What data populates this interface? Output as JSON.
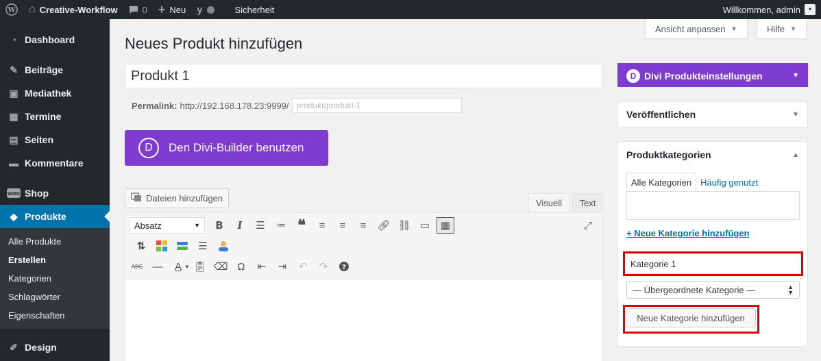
{
  "adminbar": {
    "site_name": "Creative-Workflow",
    "comments_count": "0",
    "new_label": "Neu",
    "security_label": "Sicherheit",
    "greeting": "Willkommen, admin",
    "icons": [
      "wordpress-icon",
      "home-icon",
      "comment-icon",
      "plus-icon",
      "yoast-icon",
      "status-dot-icon",
      "avatar"
    ]
  },
  "sidebar": {
    "items": [
      {
        "label": "Dashboard",
        "icon": "dashboard-icon"
      },
      {
        "label": "Beiträge",
        "icon": "pin-icon"
      },
      {
        "label": "Mediathek",
        "icon": "media-icon"
      },
      {
        "label": "Termine",
        "icon": "calendar-icon"
      },
      {
        "label": "Seiten",
        "icon": "page-icon"
      },
      {
        "label": "Kommentare",
        "icon": "comment-icon"
      },
      {
        "label": "Shop",
        "icon": "woo-icon"
      },
      {
        "label": "Produkte",
        "icon": "product-icon"
      },
      {
        "label": "Design",
        "icon": "brush-icon"
      }
    ],
    "submenu": [
      "Alle Produkte",
      "Erstellen",
      "Kategorien",
      "Schlagwörter",
      "Eigenschaften"
    ],
    "active_sub": "Erstellen",
    "accent": "#0073aa"
  },
  "header": {
    "title": "Neues Produkt hinzufügen",
    "screen_options": "Ansicht anpassen",
    "help": "Hilfe"
  },
  "post": {
    "title_value": "Produkt 1",
    "permalink_label": "Permalink:",
    "permalink_base": "http://192.168.178.23:9999/",
    "slug_placeholder": "produkt/produkt-1"
  },
  "divi": {
    "button_label": "Den Divi-Builder benutzen",
    "logo_letter": "D",
    "color": "#7e3bd0"
  },
  "editor": {
    "media_button": "Dateien hinzufügen",
    "tab_visual": "Visuell",
    "tab_text": "Text",
    "format_value": "Absatz"
  },
  "metaboxes": {
    "divi_settings": "Divi Produkteinstellungen",
    "publish": "Veröffentlichen",
    "categories": {
      "title": "Produktkategorien",
      "tab_all": "Alle Kategorien",
      "tab_popular": "Häufig genutzt",
      "add_link": "+ Neue Kategorie hinzufügen",
      "new_cat_value": "Kategorie 1",
      "parent_select": "— Übergeordnete Kategorie —",
      "submit": "Neue Kategorie hinzufügen"
    }
  },
  "highlight_color": "#e00000"
}
